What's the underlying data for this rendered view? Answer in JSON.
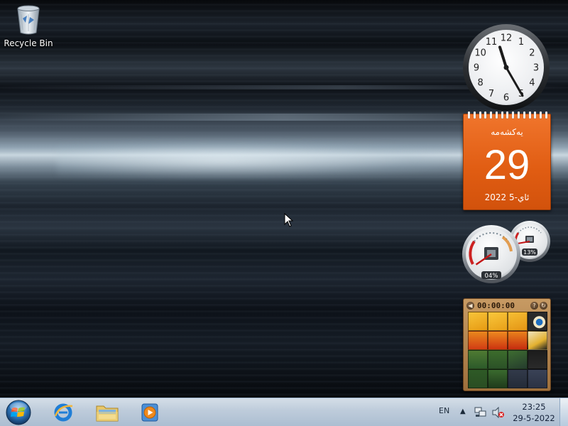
{
  "desktop": {
    "icons": [
      {
        "label": "Recycle Bin",
        "icon": "recycle-bin-icon"
      }
    ]
  },
  "gadgets": {
    "clock": {
      "numerals": [
        "12",
        "1",
        "2",
        "3",
        "4",
        "5",
        "6",
        "7",
        "8",
        "9",
        "10",
        "11"
      ],
      "time": "23:25"
    },
    "calendar": {
      "weekday": "یەکشەمە",
      "day": "29",
      "month_year": "ئاي-5 2022",
      "accent": "#e05c12"
    },
    "cpu_meter": {
      "cpu_percent": "04%",
      "memory_percent": "13%",
      "cpu_value": 4,
      "memory_value": 13
    },
    "picture_puzzle": {
      "timer": "00:00:00",
      "back_icon": "back-arrow-icon",
      "help_icon": "help-icon",
      "shuffle_icon": "shuffle-icon"
    }
  },
  "taskbar": {
    "start_icon": "windows-start-orb-icon",
    "pinned": [
      {
        "name": "Internet Explorer",
        "icon": "internet-explorer-icon"
      },
      {
        "name": "Windows Explorer",
        "icon": "folder-explorer-icon"
      },
      {
        "name": "Windows Media Player",
        "icon": "media-player-icon"
      }
    ],
    "tray": {
      "language": "EN",
      "show_hidden_icon": "▲",
      "network_icon": "network-icon",
      "volume_icon": "volume-muted-icon",
      "time": "23:25",
      "date": "29-5-2022"
    }
  },
  "colors": {
    "taskbar": "#cddcec",
    "calendar_orange": "#e05c12"
  }
}
